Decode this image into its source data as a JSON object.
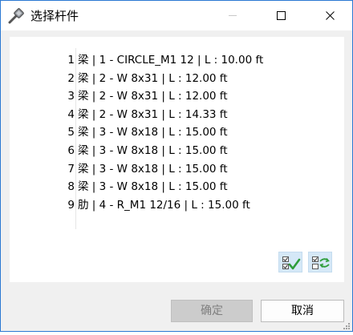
{
  "window": {
    "title": "选择杆件"
  },
  "members": [
    {
      "index": "1",
      "text": "梁 | 1 - CIRCLE_M1 12 | L : 10.00 ft"
    },
    {
      "index": "2",
      "text": "梁 | 2 - W 8x31 | L : 12.00 ft"
    },
    {
      "index": "3",
      "text": "梁 | 2 - W 8x31 | L : 12.00 ft"
    },
    {
      "index": "4",
      "text": "梁 | 2 - W 8x31 | L : 14.33 ft"
    },
    {
      "index": "5",
      "text": "梁 | 3 - W 8x18 | L : 15.00 ft"
    },
    {
      "index": "6",
      "text": "梁 | 3 - W 8x18 | L : 15.00 ft"
    },
    {
      "index": "7",
      "text": "梁 | 3 - W 8x18 | L : 15.00 ft"
    },
    {
      "index": "8",
      "text": "梁 | 3 - W 8x18 | L : 15.00 ft"
    },
    {
      "index": "9",
      "text": "肋 | 4 - R_M1 12/16 | L : 15.00 ft"
    }
  ],
  "toolbar": {
    "select_all_icon": "check-all-icon",
    "invert_icon": "invert-selection-icon"
  },
  "buttons": {
    "ok_label": "确定",
    "cancel_label": "取消"
  },
  "colors": {
    "border": "#2b79d3",
    "tool_button_bg": "#d5e8f7",
    "check_green": "#2e9d3a"
  }
}
